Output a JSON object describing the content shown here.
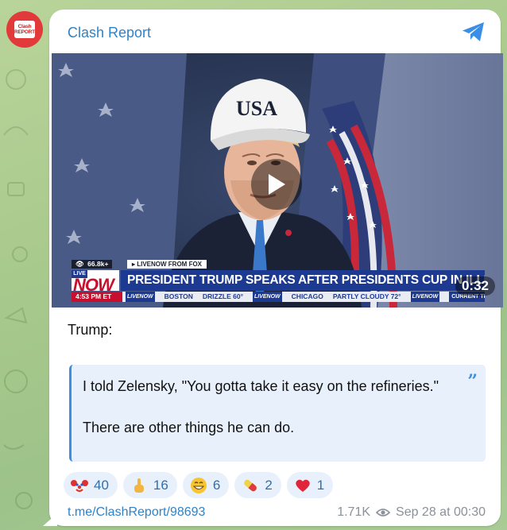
{
  "channel": {
    "name": "Clash Report",
    "avatar_text_line1": "Clash",
    "avatar_text_line2": "REPORT"
  },
  "video": {
    "duration": "0:32",
    "hat_text": "USA",
    "lower_third": {
      "views": "66.8k+",
      "source": "▸ LIVENOW FROM FOX",
      "live_label": "LIVE",
      "now_label": "NOW",
      "headline": "PRESIDENT TRUMP SPEAKS AFTER PRESIDENTS CUP IN ILLINOIS",
      "time": "4:53 PM ET",
      "ticker": [
        "BOSTON",
        "DRIZZLE 60°",
        "CHICAGO",
        "PARTLY CLOUDY 72°"
      ],
      "ticker_logo": "LIVENOW",
      "ticker_end": "CURRENT TEMPS"
    }
  },
  "post": {
    "intro": "Trump:",
    "quote_line1": "I told Zelensky, \"You gotta take it easy on the refineries.\"",
    "quote_line2": "There are other things he can do."
  },
  "reactions": [
    {
      "icon": "clown-emoji",
      "count": "40"
    },
    {
      "icon": "middle-finger-emoji",
      "count": "16"
    },
    {
      "icon": "grinning-emoji",
      "count": "6"
    },
    {
      "icon": "pill-emoji",
      "count": "2"
    },
    {
      "icon": "red-heart-emoji",
      "count": "1"
    }
  ],
  "footer": {
    "link": "t.me/ClashReport/98693",
    "views": "1.71K",
    "date": "Sep 28 at 00:30"
  },
  "colors": {
    "link_blue": "#2f82c7",
    "quote_bar": "#3a8ee6",
    "quote_bg": "#e8f1fb",
    "reaction_bg": "#e7f0fb",
    "avatar_red": "#e23a3a"
  }
}
